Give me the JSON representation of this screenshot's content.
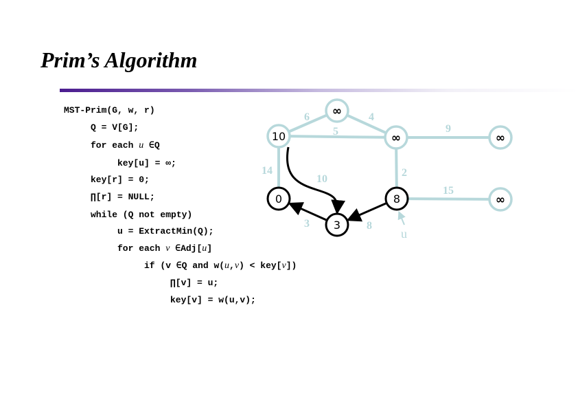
{
  "slide": {
    "title": "Prim’s Algorithm"
  },
  "code": {
    "lines": [
      "MST-Prim(G, w, r)",
      "Q = V[G];",
      "for each ",
      "key[u] = ∞;",
      "key[r] = 0;",
      "∏[r] = NULL;",
      "while (Q not empty)",
      "u = ExtractMin(Q);",
      "for each ",
      "if (v ∈Q and w(",
      "∏[v] = u;",
      "key[v] = w(u,v);"
    ],
    "for_each_u_var": "u",
    "for_each_u_rest": " ∈Q",
    "for_each_v_var": "v",
    "for_each_v_rest": " ∈Adj[",
    "for_each_v_u": "u",
    "for_each_v_end": "]",
    "if_u": "u",
    "if_comma": ",",
    "if_v": "v",
    "if_rest": ") < key[",
    "if_v2": "v",
    "if_end": "])"
  },
  "graph": {
    "colors": {
      "inactive": "#b7d8db",
      "active": "#000000"
    },
    "nodes": [
      {
        "id": "top",
        "label": "∞",
        "state": "inactive"
      },
      {
        "id": "left",
        "label": "10",
        "state": "inactive"
      },
      {
        "id": "mid-right",
        "label": "∞",
        "state": "inactive"
      },
      {
        "id": "far-right-top",
        "label": "∞",
        "state": "inactive"
      },
      {
        "id": "root",
        "label": "0",
        "state": "active"
      },
      {
        "id": "bottom",
        "label": "3",
        "state": "active"
      },
      {
        "id": "u-node",
        "label": "8",
        "state": "active"
      },
      {
        "id": "far-right-bottom",
        "label": "∞",
        "state": "inactive"
      }
    ],
    "edges": [
      {
        "from": "left",
        "to": "top",
        "weight": "6",
        "tree": false
      },
      {
        "from": "top",
        "to": "mid-right",
        "weight": "4",
        "tree": false
      },
      {
        "from": "left",
        "to": "mid-right",
        "weight": "5",
        "tree": false
      },
      {
        "from": "mid-right",
        "to": "far-right-top",
        "weight": "9",
        "tree": false
      },
      {
        "from": "left",
        "to": "root",
        "weight": "14",
        "tree": false
      },
      {
        "from": "left",
        "to": "bottom",
        "weight": "10",
        "tree": true
      },
      {
        "from": "mid-right",
        "to": "u-node",
        "weight": "2",
        "tree": false
      },
      {
        "from": "u-node",
        "to": "far-right-bottom",
        "weight": "15",
        "tree": false
      },
      {
        "from": "bottom",
        "to": "root",
        "weight": "3",
        "tree": true
      },
      {
        "from": "u-node",
        "to": "bottom",
        "weight": "8",
        "tree": true
      }
    ],
    "pointer_label": "u"
  }
}
